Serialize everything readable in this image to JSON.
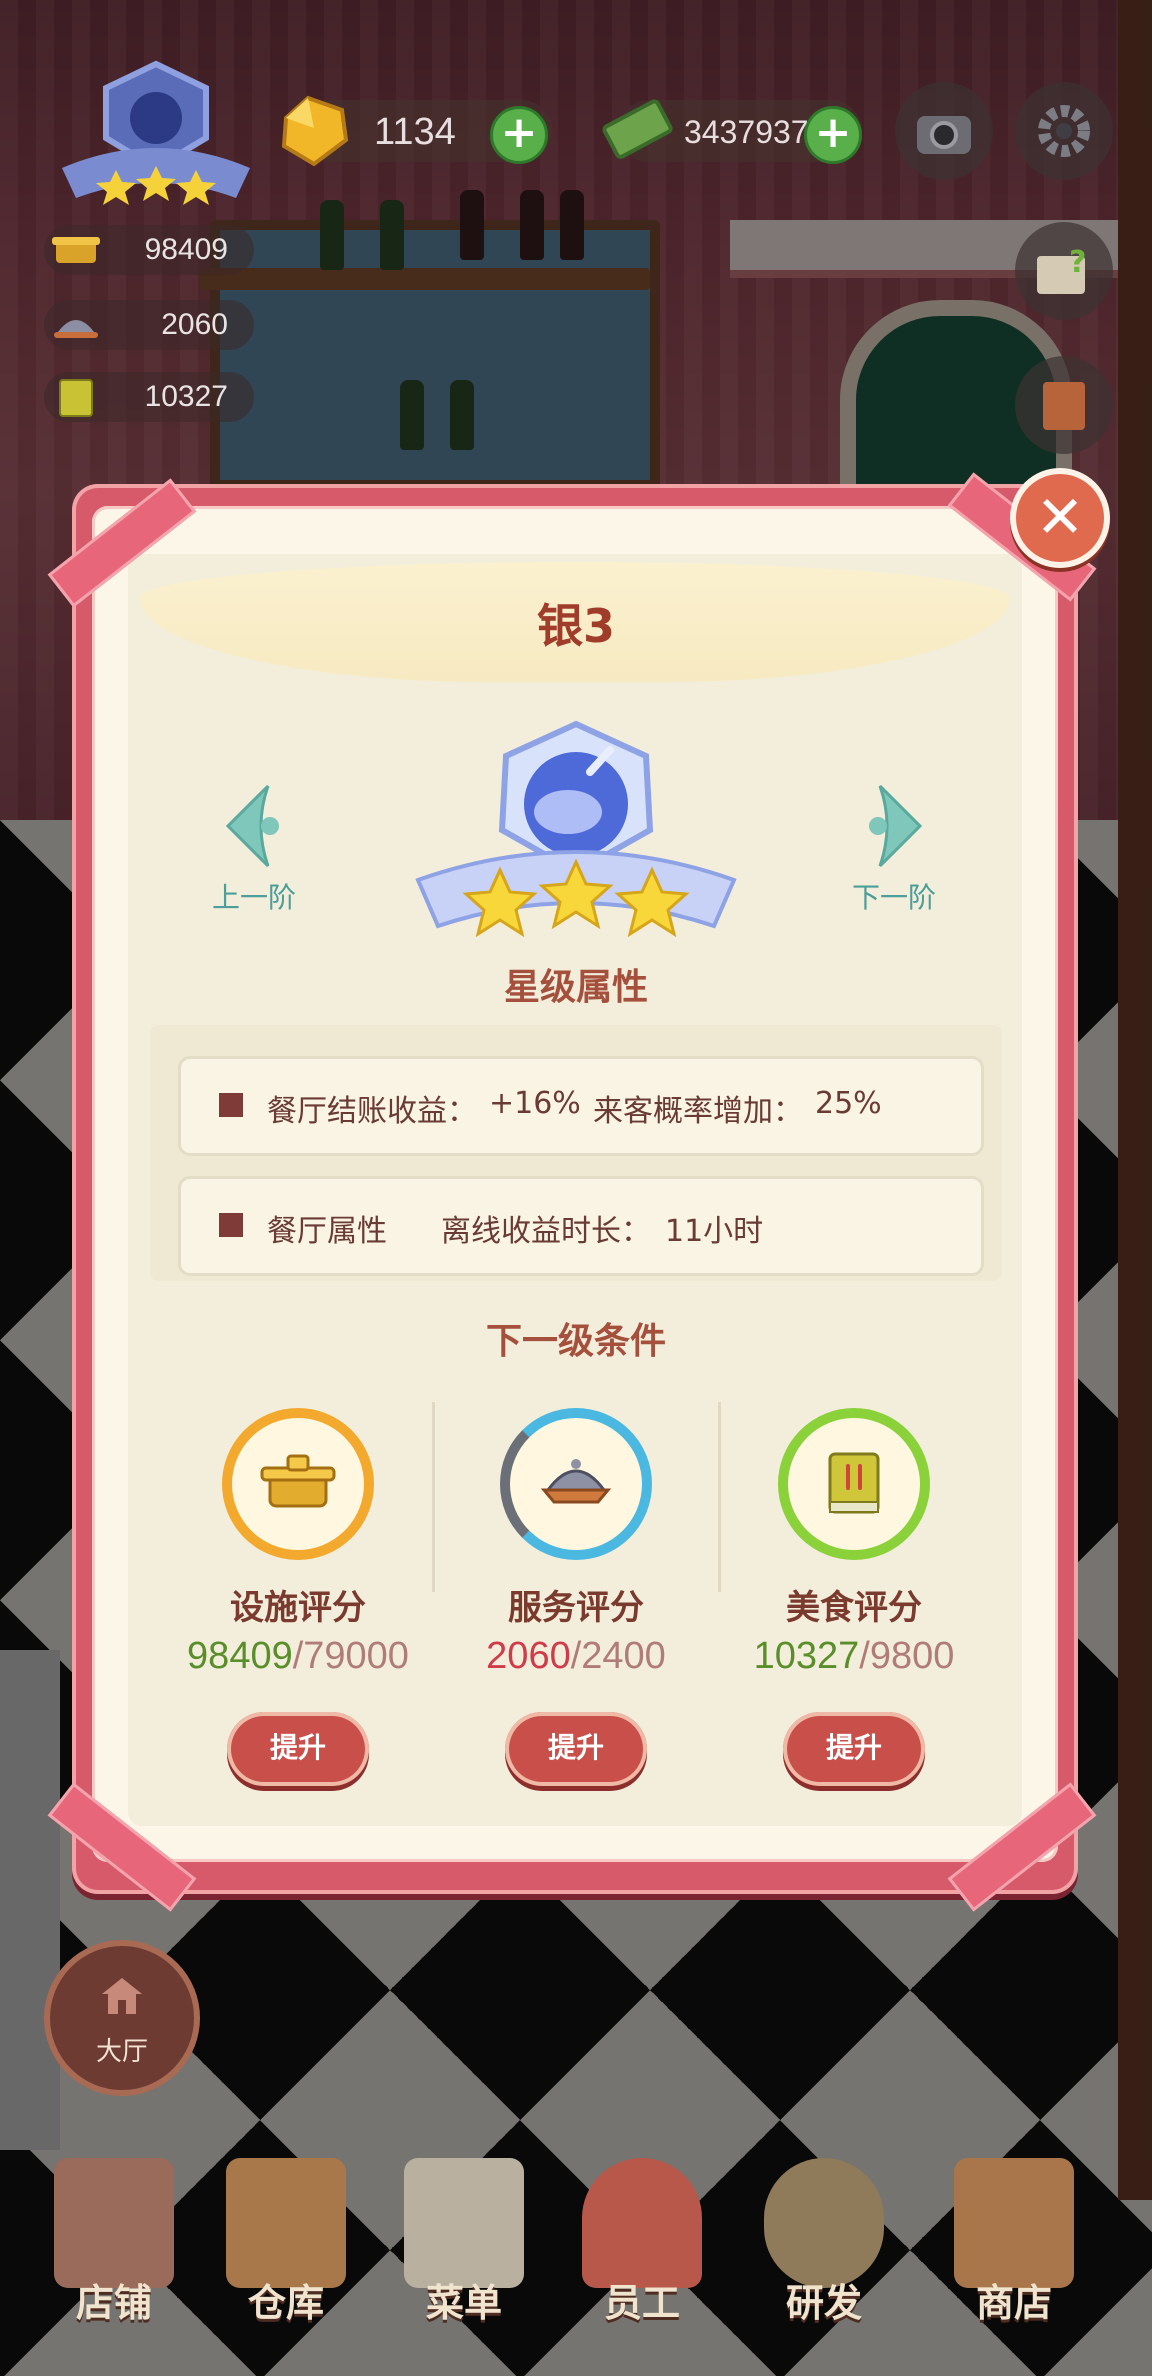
{
  "hud": {
    "gems": "1134",
    "cash": "3437937",
    "facility_score": "98409",
    "service_score": "2060",
    "food_score": "10327"
  },
  "dialog": {
    "title": "银3",
    "prev_label": "上一阶",
    "next_label": "下一阶",
    "star_attributes_title": "星级属性",
    "attributes": [
      {
        "label": "餐厅结账收益：",
        "value": "+16%",
        "label2": "来客概率增加：",
        "value2": "25%"
      },
      {
        "label": "餐厅属性",
        "sub_label": "离线收益时长：",
        "value": "11小时"
      }
    ],
    "next_level_title": "下一级条件",
    "requirements": [
      {
        "name": "设施评分",
        "current": "98409",
        "required": "/79000",
        "button": "提升",
        "ring_color": "#f2a92e",
        "met": true
      },
      {
        "name": "服务评分",
        "current": "2060",
        "required": "/2400",
        "button": "提升",
        "ring_color": "#4ab8e0",
        "met": false
      },
      {
        "name": "美食评分",
        "current": "10327",
        "required": "/9800",
        "button": "提升",
        "ring_color": "#8ad13a",
        "met": true
      }
    ]
  },
  "hall_label": "大厅",
  "bottom_nav": [
    "店铺",
    "仓库",
    "菜单",
    "员工",
    "研发",
    "商店"
  ]
}
